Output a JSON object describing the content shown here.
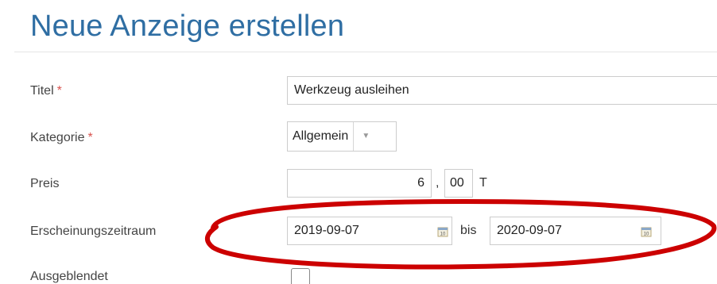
{
  "page": {
    "title": "Neue Anzeige erstellen"
  },
  "form": {
    "title_field": {
      "label": "Titel",
      "required_mark": "*",
      "value": "Werkzeug ausleihen"
    },
    "category_field": {
      "label": "Kategorie",
      "required_mark": "*",
      "selected": "Allgemein",
      "arrow_icon": "caret-down-icon"
    },
    "price_field": {
      "label": "Preis",
      "whole": "6",
      "separator": ",",
      "fraction": "00",
      "unit": "T"
    },
    "period_field": {
      "label": "Erscheinungszeitraum",
      "from": "2019-09-07",
      "between_label": "bis",
      "to": "2020-09-07",
      "calendar_icon": "calendar-icon"
    },
    "hidden_field": {
      "label": "Ausgeblendet",
      "checked": false
    }
  },
  "colors": {
    "title": "#2f6ea3",
    "required": "#d9534f",
    "annotation": "#cc0000"
  }
}
